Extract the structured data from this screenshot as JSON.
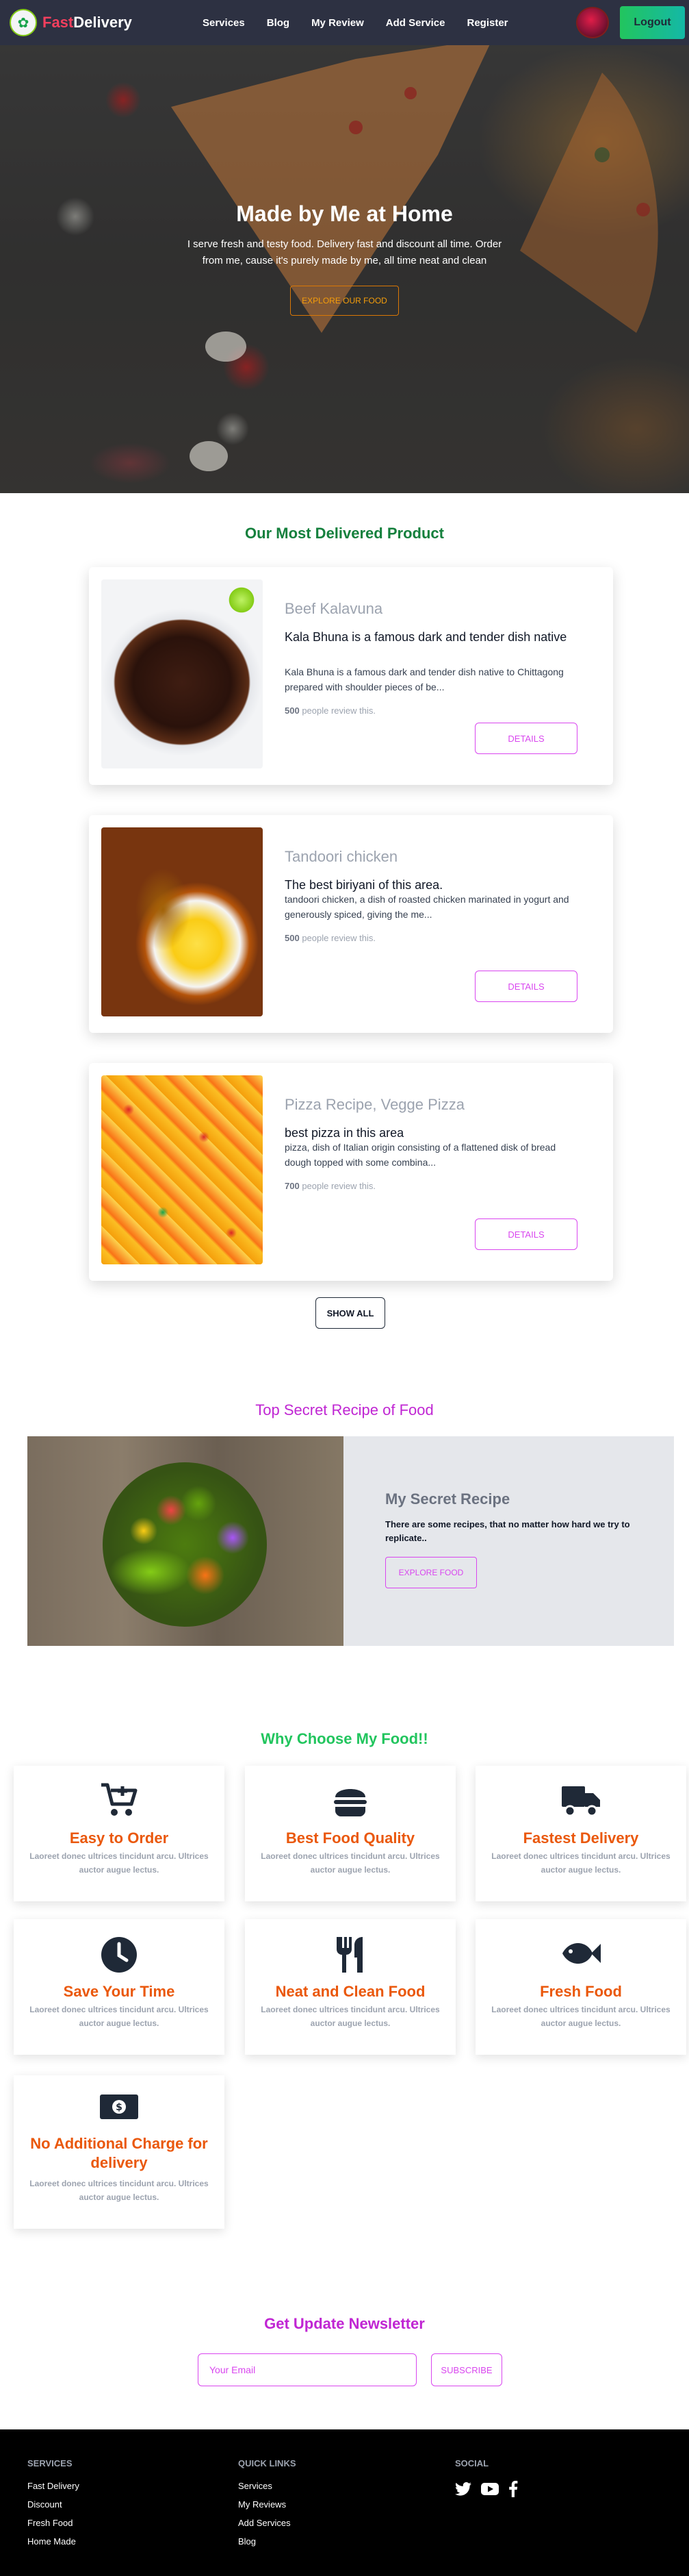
{
  "nav": {
    "brand_accent": "Fast",
    "brand_rest": "Delivery",
    "links": [
      "Services",
      "Blog",
      "My Review",
      "Add Service",
      "Register"
    ],
    "logout_label": "Logout"
  },
  "hero": {
    "title": "Made by Me at Home",
    "text": "I serve fresh and testy food. Delivery fast and discount all time. Order from me, cause it's purely made by me, all time neat and clean",
    "button_label": "EXPLORE OUR FOOD"
  },
  "products": {
    "heading": "Our Most Delivered Product",
    "items": [
      {
        "name": "Beef Kalavuna",
        "tagline": "Kala Bhuna is a famous dark and tender dish native",
        "description": "Kala Bhuna is a famous dark and tender dish native to Chittagong prepared with shoulder pieces of be...",
        "review_count": "500",
        "review_suffix": " people review this.",
        "button_label": "DETAILS"
      },
      {
        "name": "Tandoori chicken",
        "tagline": "The best biriyani of this area.",
        "description": "tandoori chicken, a dish of roasted chicken marinated in yogurt and generously spiced, giving the me...",
        "review_count": "500",
        "review_suffix": " people review this.",
        "button_label": "DETAILS"
      },
      {
        "name": "Pizza Recipe, Vegge Pizza",
        "tagline": "best pizza in this area",
        "description": "pizza, dish of Italian origin consisting of a flattened disk of bread dough topped with some combina...",
        "review_count": "700",
        "review_suffix": " people review this.",
        "button_label": "DETAILS"
      }
    ],
    "show_all_label": "SHOW ALL"
  },
  "secret": {
    "heading": "Top Secret Recipe of Food",
    "title": "My Secret Recipe",
    "text": "There are some recipes, that no matter how hard we try to replicate..",
    "button_label": "EXPLORE FOOD"
  },
  "features": {
    "heading": "Why Choose My Food!!",
    "items": [
      {
        "title": "Easy to Order",
        "icon": "cart-plus-icon",
        "description": "Laoreet donec ultrices tincidunt arcu. Ultrices auctor augue lectus."
      },
      {
        "title": "Best Food Quality",
        "icon": "hamburger-icon",
        "description": "Laoreet donec ultrices tincidunt arcu. Ultrices auctor augue lectus."
      },
      {
        "title": "Fastest Delivery",
        "icon": "truck-icon",
        "description": "Laoreet donec ultrices tincidunt arcu. Ultrices auctor augue lectus."
      },
      {
        "title": "Save Your Time",
        "icon": "clock-icon",
        "description": "Laoreet donec ultrices tincidunt arcu. Ultrices auctor augue lectus."
      },
      {
        "title": "Neat and Clean Food",
        "icon": "utensils-icon",
        "description": "Laoreet donec ultrices tincidunt arcu. Ultrices auctor augue lectus."
      },
      {
        "title": "Fresh Food",
        "icon": "fish-icon",
        "description": "Laoreet donec ultrices tincidunt arcu. Ultrices auctor augue lectus."
      },
      {
        "title": "No Additional Charge for delivery",
        "icon": "money-bill-icon",
        "description": "Laoreet donec ultrices tincidunt arcu. Ultrices auctor augue lectus."
      }
    ]
  },
  "newsletter": {
    "heading": "Get Update Newsletter",
    "placeholder": "Your Email",
    "button_label": "SUBSCRIBE"
  },
  "footer": {
    "services_heading": "SERVICES",
    "services_links": [
      "Fast Delivery",
      "Discount",
      "Fresh Food",
      "Home Made"
    ],
    "quick_heading": "QUICK LINKS",
    "quick_links": [
      "Services",
      "My Reviews",
      "Add Services",
      "Blog"
    ],
    "social_heading": "SOCIAL"
  },
  "colors": {
    "nav_bg": "#2d3142",
    "brand_accent": "#f43f5e",
    "heading_green": "#15803d",
    "heading_pink": "#c026d3",
    "feature_orange": "#ea580c",
    "button_magenta": "#d946ef"
  }
}
